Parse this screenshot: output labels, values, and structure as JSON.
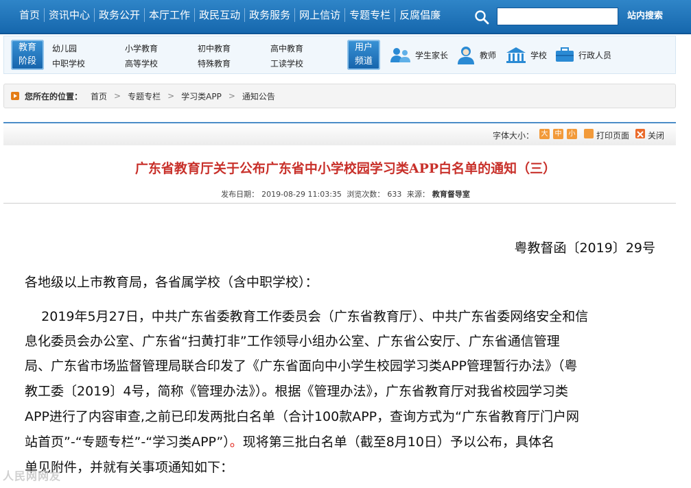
{
  "nav": {
    "links": [
      "首页",
      "资讯中心",
      "政务公开",
      "本厅工作",
      "政民互动",
      "政务服务",
      "网上信访",
      "专题专栏",
      "反腐倡廉"
    ],
    "search_button": "站内搜索"
  },
  "categories": {
    "edu_tag": [
      "教育",
      "阶段"
    ],
    "edu_items": [
      "幼儿园",
      "小学教育",
      "初中教育",
      "高中教育",
      "中职学校",
      "高等学校",
      "特殊教育",
      "工读学校"
    ],
    "user_tag": [
      "用户",
      "频道"
    ],
    "user_items": [
      {
        "label": "学生家长",
        "icon": "parents-icon"
      },
      {
        "label": "教师",
        "icon": "teacher-icon"
      },
      {
        "label": "学校",
        "icon": "school-icon"
      },
      {
        "label": "行政人员",
        "icon": "briefcase-icon"
      }
    ]
  },
  "breadcrumb": {
    "lead": "您所在的位置：",
    "items": [
      "首页",
      "专题专栏",
      "学习类APP",
      "通知公告"
    ]
  },
  "tools": {
    "font_size_label": "字体大小：",
    "sizes": [
      "大",
      "中",
      "小"
    ],
    "print": "打印页面",
    "close": "关闭"
  },
  "article": {
    "title": "广东省教育厅关于公布广东省中小学校园学习类APP白名单的通知（三）",
    "publish_label": "发布日期：",
    "publish_date": "2019-08-29 11:03:35",
    "views_label": "浏览次数：",
    "views": "633",
    "source_label": "来源：",
    "source": "教育督导室",
    "doc_number": "粤教督函〔2019〕29号",
    "salutation": "各地级以上市教育局，各省属学校（含中职学校）：",
    "lines": [
      "    2019年5月27日，中共广东省委教育工作委员会（广东省教育厅）、中共广东省委网络安全和信",
      "息化委员会办公室、广东省“扫黄打非”工作领导小组办公室、广东省公安厅、广东省通信管理",
      "局、广东省市场监督管理局联合印发了《广东省面向中小学生校园学习类APP管理暂行办法》（粤",
      "教工委〔2019〕4号，简称《管理办法》）。根据《管理办法》，广东省教育厅对我省校园学习类",
      "APP进行了内容审查,之前已印发两批白名单（合计100款APP，查询方式为“广东省教育厅门户网",
      "站首页”-“专题专栏”-“学习类APP”）",
      "。",
      "现将第三批白名单（截至8月10日）予以公布，具体名",
      "单见附件，并就有关事项通知如下："
    ]
  },
  "watermark": "人民网网友",
  "colors": {
    "nav_blue": "#1667ad",
    "title_red": "#c8302a",
    "accent_orange": "#f29a3a"
  }
}
